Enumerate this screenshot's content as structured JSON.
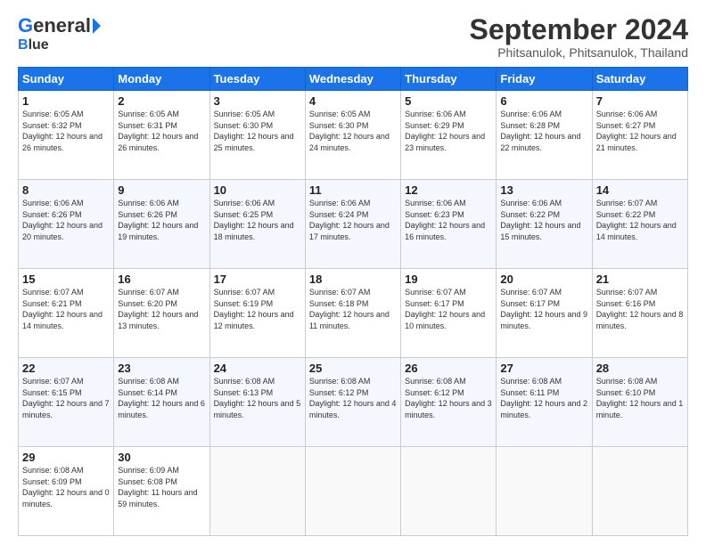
{
  "header": {
    "logo_g": "G",
    "logo_eneral": "eneral",
    "logo_b": "B",
    "logo_lue": "lue",
    "title": "September 2024",
    "subtitle": "Phitsanulok, Phitsanulok, Thailand"
  },
  "columns": [
    "Sunday",
    "Monday",
    "Tuesday",
    "Wednesday",
    "Thursday",
    "Friday",
    "Saturday"
  ],
  "weeks": [
    [
      {
        "day": "1",
        "sunrise": "Sunrise: 6:05 AM",
        "sunset": "Sunset: 6:32 PM",
        "daylight": "Daylight: 12 hours and 26 minutes."
      },
      {
        "day": "2",
        "sunrise": "Sunrise: 6:05 AM",
        "sunset": "Sunset: 6:31 PM",
        "daylight": "Daylight: 12 hours and 26 minutes."
      },
      {
        "day": "3",
        "sunrise": "Sunrise: 6:05 AM",
        "sunset": "Sunset: 6:30 PM",
        "daylight": "Daylight: 12 hours and 25 minutes."
      },
      {
        "day": "4",
        "sunrise": "Sunrise: 6:05 AM",
        "sunset": "Sunset: 6:30 PM",
        "daylight": "Daylight: 12 hours and 24 minutes."
      },
      {
        "day": "5",
        "sunrise": "Sunrise: 6:06 AM",
        "sunset": "Sunset: 6:29 PM",
        "daylight": "Daylight: 12 hours and 23 minutes."
      },
      {
        "day": "6",
        "sunrise": "Sunrise: 6:06 AM",
        "sunset": "Sunset: 6:28 PM",
        "daylight": "Daylight: 12 hours and 22 minutes."
      },
      {
        "day": "7",
        "sunrise": "Sunrise: 6:06 AM",
        "sunset": "Sunset: 6:27 PM",
        "daylight": "Daylight: 12 hours and 21 minutes."
      }
    ],
    [
      {
        "day": "8",
        "sunrise": "Sunrise: 6:06 AM",
        "sunset": "Sunset: 6:26 PM",
        "daylight": "Daylight: 12 hours and 20 minutes."
      },
      {
        "day": "9",
        "sunrise": "Sunrise: 6:06 AM",
        "sunset": "Sunset: 6:26 PM",
        "daylight": "Daylight: 12 hours and 19 minutes."
      },
      {
        "day": "10",
        "sunrise": "Sunrise: 6:06 AM",
        "sunset": "Sunset: 6:25 PM",
        "daylight": "Daylight: 12 hours and 18 minutes."
      },
      {
        "day": "11",
        "sunrise": "Sunrise: 6:06 AM",
        "sunset": "Sunset: 6:24 PM",
        "daylight": "Daylight: 12 hours and 17 minutes."
      },
      {
        "day": "12",
        "sunrise": "Sunrise: 6:06 AM",
        "sunset": "Sunset: 6:23 PM",
        "daylight": "Daylight: 12 hours and 16 minutes."
      },
      {
        "day": "13",
        "sunrise": "Sunrise: 6:06 AM",
        "sunset": "Sunset: 6:22 PM",
        "daylight": "Daylight: 12 hours and 15 minutes."
      },
      {
        "day": "14",
        "sunrise": "Sunrise: 6:07 AM",
        "sunset": "Sunset: 6:22 PM",
        "daylight": "Daylight: 12 hours and 14 minutes."
      }
    ],
    [
      {
        "day": "15",
        "sunrise": "Sunrise: 6:07 AM",
        "sunset": "Sunset: 6:21 PM",
        "daylight": "Daylight: 12 hours and 14 minutes."
      },
      {
        "day": "16",
        "sunrise": "Sunrise: 6:07 AM",
        "sunset": "Sunset: 6:20 PM",
        "daylight": "Daylight: 12 hours and 13 minutes."
      },
      {
        "day": "17",
        "sunrise": "Sunrise: 6:07 AM",
        "sunset": "Sunset: 6:19 PM",
        "daylight": "Daylight: 12 hours and 12 minutes."
      },
      {
        "day": "18",
        "sunrise": "Sunrise: 6:07 AM",
        "sunset": "Sunset: 6:18 PM",
        "daylight": "Daylight: 12 hours and 11 minutes."
      },
      {
        "day": "19",
        "sunrise": "Sunrise: 6:07 AM",
        "sunset": "Sunset: 6:17 PM",
        "daylight": "Daylight: 12 hours and 10 minutes."
      },
      {
        "day": "20",
        "sunrise": "Sunrise: 6:07 AM",
        "sunset": "Sunset: 6:17 PM",
        "daylight": "Daylight: 12 hours and 9 minutes."
      },
      {
        "day": "21",
        "sunrise": "Sunrise: 6:07 AM",
        "sunset": "Sunset: 6:16 PM",
        "daylight": "Daylight: 12 hours and 8 minutes."
      }
    ],
    [
      {
        "day": "22",
        "sunrise": "Sunrise: 6:07 AM",
        "sunset": "Sunset: 6:15 PM",
        "daylight": "Daylight: 12 hours and 7 minutes."
      },
      {
        "day": "23",
        "sunrise": "Sunrise: 6:08 AM",
        "sunset": "Sunset: 6:14 PM",
        "daylight": "Daylight: 12 hours and 6 minutes."
      },
      {
        "day": "24",
        "sunrise": "Sunrise: 6:08 AM",
        "sunset": "Sunset: 6:13 PM",
        "daylight": "Daylight: 12 hours and 5 minutes."
      },
      {
        "day": "25",
        "sunrise": "Sunrise: 6:08 AM",
        "sunset": "Sunset: 6:12 PM",
        "daylight": "Daylight: 12 hours and 4 minutes."
      },
      {
        "day": "26",
        "sunrise": "Sunrise: 6:08 AM",
        "sunset": "Sunset: 6:12 PM",
        "daylight": "Daylight: 12 hours and 3 minutes."
      },
      {
        "day": "27",
        "sunrise": "Sunrise: 6:08 AM",
        "sunset": "Sunset: 6:11 PM",
        "daylight": "Daylight: 12 hours and 2 minutes."
      },
      {
        "day": "28",
        "sunrise": "Sunrise: 6:08 AM",
        "sunset": "Sunset: 6:10 PM",
        "daylight": "Daylight: 12 hours and 1 minute."
      }
    ],
    [
      {
        "day": "29",
        "sunrise": "Sunrise: 6:08 AM",
        "sunset": "Sunset: 6:09 PM",
        "daylight": "Daylight: 12 hours and 0 minutes."
      },
      {
        "day": "30",
        "sunrise": "Sunrise: 6:09 AM",
        "sunset": "Sunset: 6:08 PM",
        "daylight": "Daylight: 11 hours and 59 minutes."
      },
      null,
      null,
      null,
      null,
      null
    ]
  ]
}
